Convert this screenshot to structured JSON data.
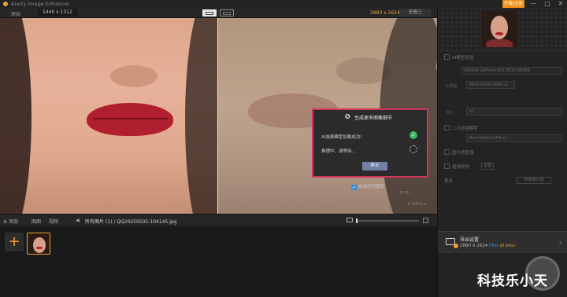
{
  "window": {
    "title": "Aiarty Image Enhancer",
    "upgrade_label": "升级/注册",
    "minimize": "—",
    "maximize": "□",
    "close": "✕"
  },
  "toolbar": {
    "original_label": "原始",
    "original_size": "1440 x 1312",
    "output_size": "2880 x 2624",
    "preview_label": "查看已"
  },
  "dialog": {
    "title": "生成更多图像细节",
    "row1": "AI选择模型加载成功!",
    "row2": "推理中，请等待...",
    "stop_label": "终止",
    "check_glyph": "✓",
    "icon_glyph": "✪"
  },
  "auto_open": {
    "checkbox_glyph": "✓",
    "label": "自动打开图库"
  },
  "zoom": {
    "top": "⟲ ⊡",
    "level": "⊖ 100% ▾"
  },
  "filebar": {
    "add": "⊕ 添加",
    "tab_image": "图图",
    "tab_video": "视频",
    "path": "所有图片 (1) / QQ20250505-104145.jpg",
    "back": "◀"
  },
  "filmstrip": {
    "add_glyph": "+"
  },
  "right_panel": {
    "ai_section": "AI模型增强",
    "gpu": "NVIDIA GeForce RTX 3070 SUPER",
    "model_label": "AI模型",
    "model": "More Detail GAN v2",
    "scale_label": "放大",
    "scale": "x2",
    "denoise_section": "二次增强模型",
    "denoise_model": "Real-Detail GAN v2",
    "face_section": "图片修复器",
    "sharpen_section": "增强视觉",
    "sharpen_btn": "设置",
    "more_section": "更多",
    "restore_btn": "恢复默认值"
  },
  "export": {
    "title": "导出设置",
    "dims": "2880 X 2624",
    "format": "PNG",
    "depth": "(8 bits)",
    "chevron": "›"
  },
  "watermark": "科技乐小天",
  "colors": {
    "accent": "#f0a030",
    "dialog_border": "#d2335c",
    "success": "#3bb85a",
    "link_blue": "#3c8de0"
  }
}
